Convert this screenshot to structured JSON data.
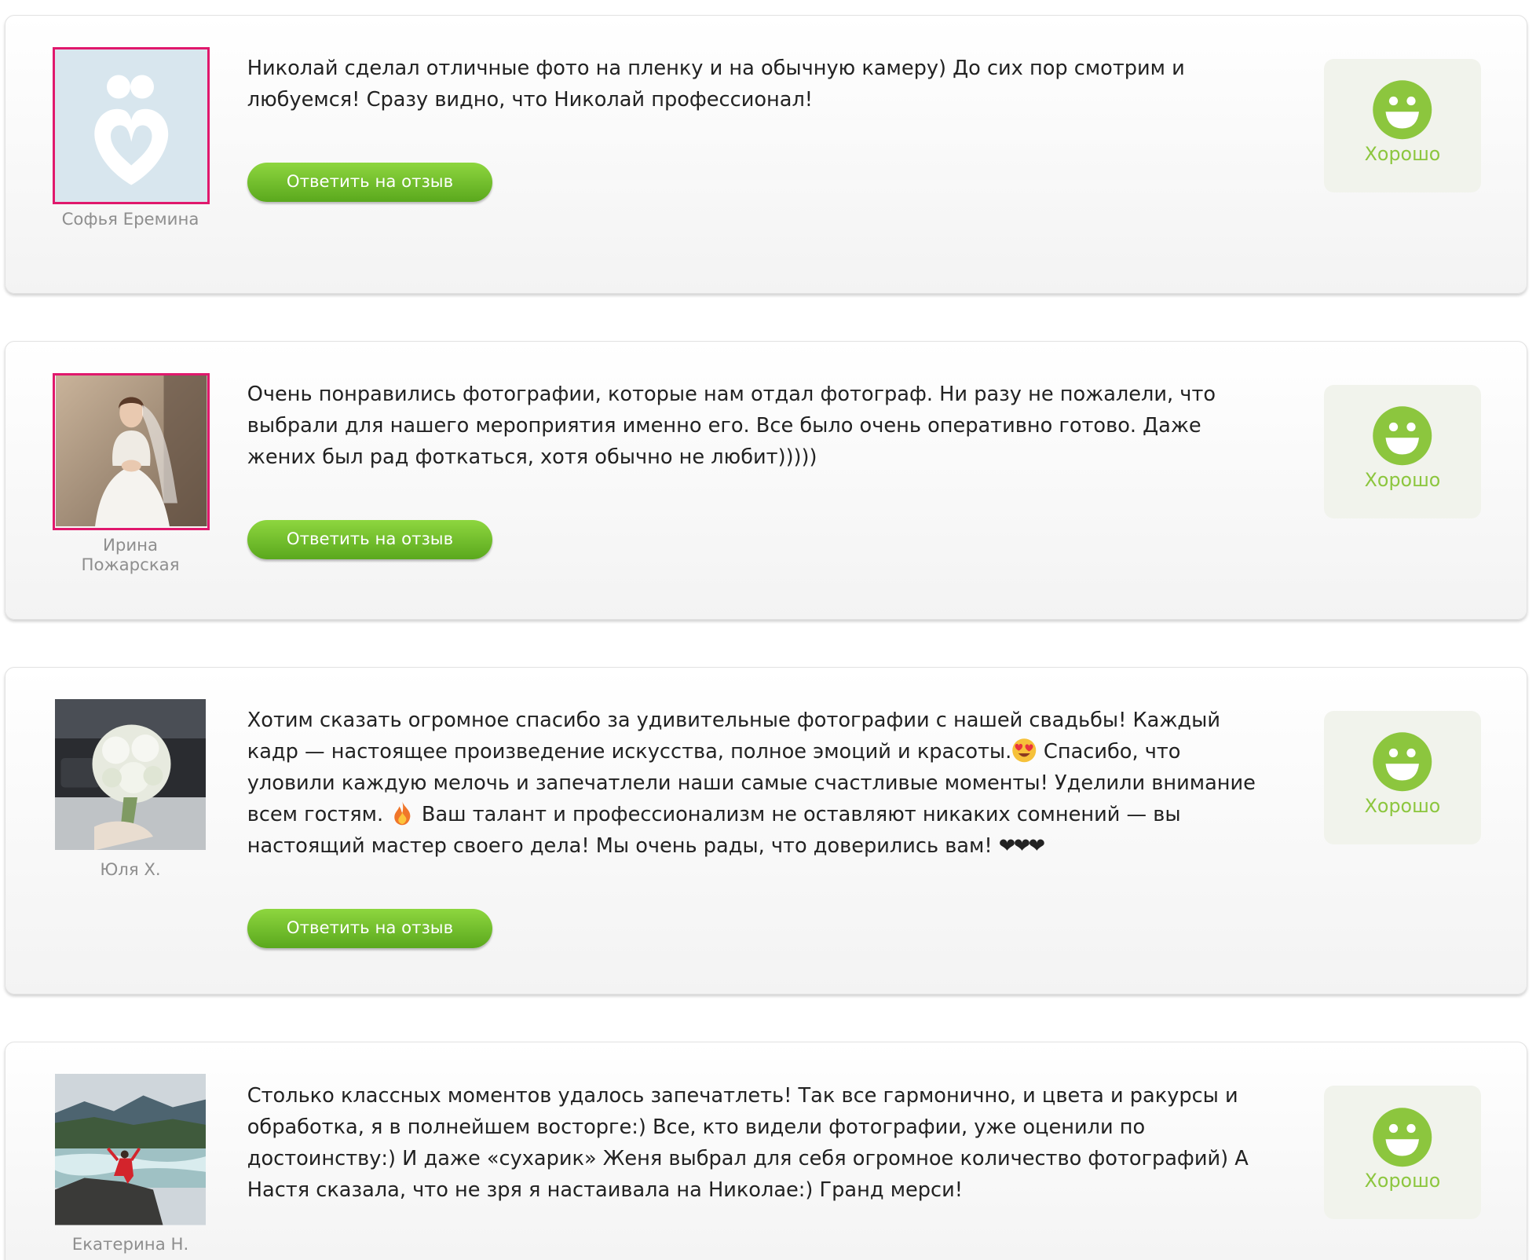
{
  "reviews": [
    {
      "author": "Софья Еремина",
      "avatar": "placeholder-heart-logo",
      "text": "Николай сделал отличные фото на пленку и на обычную камеру) До сих пор смотрим и любуемся! Сразу видно, что Николай профессионал!",
      "reply_label": "Ответить на отзыв",
      "rating_label": "Хорошо",
      "rating_icon": "smile-icon"
    },
    {
      "author": "Ирина Пожарская",
      "avatar": "bride-photo",
      "text": "Очень понравились фотографии, которые нам отдал фотограф. Ни разу не пожалели, что выбрали для нашего мероприятия именно его. Все было очень оперативно готово. Даже жених был рад фоткаться, хотя обычно не любит)))))",
      "reply_label": "Ответить на отзыв",
      "rating_label": "Хорошо",
      "rating_icon": "smile-icon"
    },
    {
      "author": "Юля Х.",
      "avatar": "bouquet-photo",
      "text_parts": [
        "Хотим сказать огромное спасибо за удивительные фотографии с нашей свадьбы! Каждый кадр — настоящее произведение искусства, полное эмоций и красоты.",
        " Спасибо, что уловили каждую мелочь и запечатлели наши самые счастливые моменты! Уделили внимание всем гостям. ",
        " Ваш талант и профессионализм не оставляют никаких сомнений — вы настоящий мастер своего дела! Мы очень рады, что доверились вам! ",
        "❤❤❤"
      ],
      "emoji_icons": [
        "heart-eyes-emoji-icon",
        "fire-emoji-icon"
      ],
      "reply_label": "Ответить на отзыв",
      "rating_label": "Хорошо",
      "rating_icon": "smile-icon"
    },
    {
      "author": "Екатерина Н.",
      "avatar": "mountain-river-photo",
      "text": "Столько классных моментов удалось запечатлеть! Так все гармонично, и цвета и ракурсы и обработка, я в полнейшем восторге:) Все, кто видели фотографии, уже оценили по достоинству:) И даже «сухарик» Женя выбрал для себя огромное количество фотографий) А Настя сказала, что не зря я настаивала на Николае:) Гранд мерси!",
      "rating_label": "Хорошо",
      "rating_icon": "smile-icon"
    }
  ],
  "colors": {
    "accent_green": "#8cc63e",
    "button_green": "#5aa81d",
    "avatar_frame": "#e0186c",
    "author_gray": "#8e8e8e"
  }
}
